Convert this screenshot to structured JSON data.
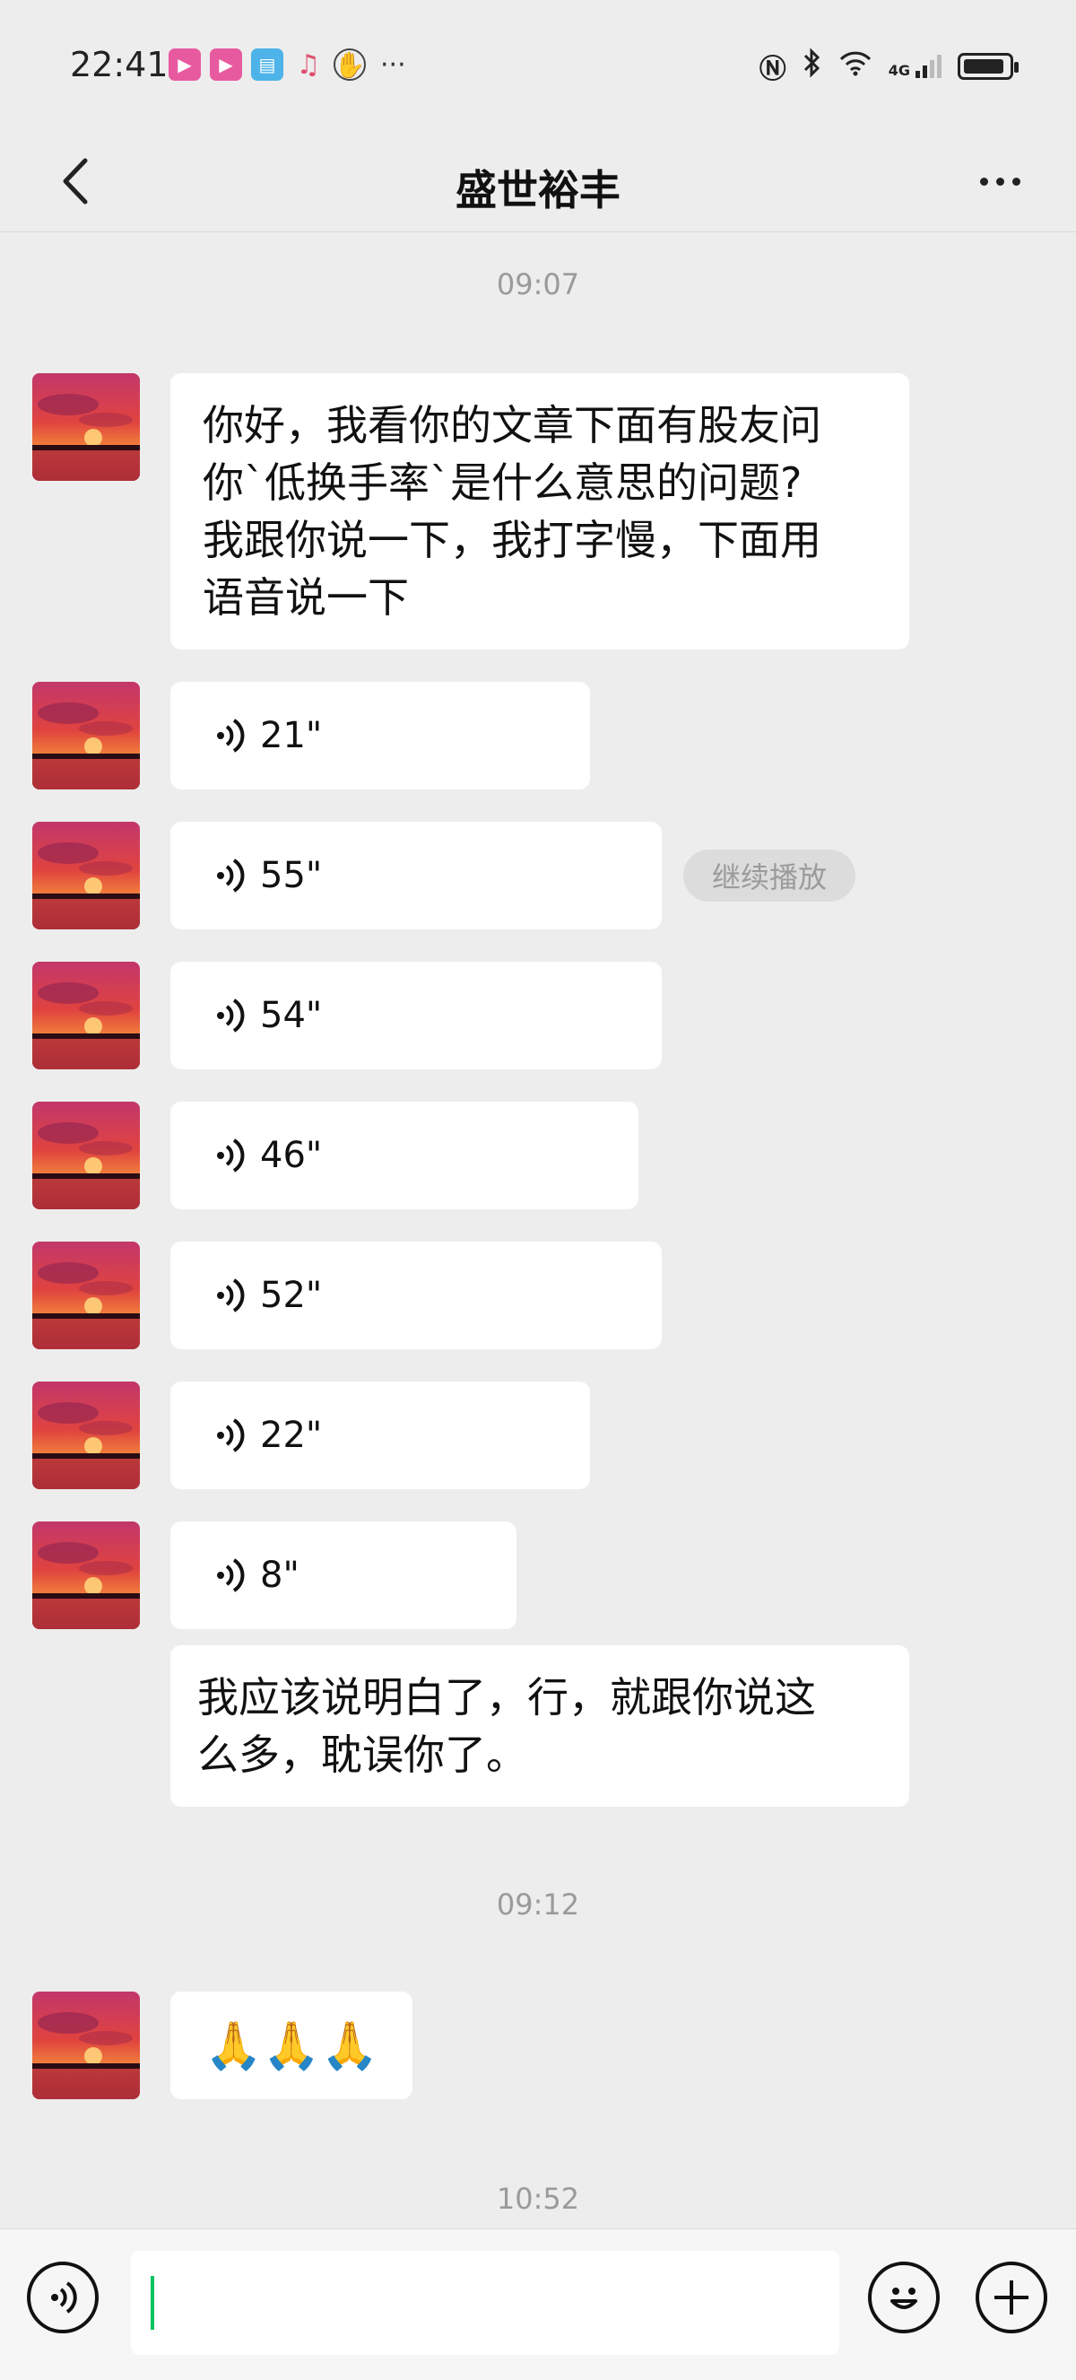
{
  "status_bar": {
    "time": "22:41",
    "app_icons": [
      "video-app-icon",
      "video-app-icon",
      "reader-app-icon",
      "music-app-icon",
      "hand-icon"
    ],
    "more": "···",
    "signal": "4G",
    "icons": [
      "nfc-icon",
      "bluetooth-icon",
      "wifi-icon",
      "signal-icon",
      "battery-icon"
    ]
  },
  "header": {
    "title": "盛世裕丰"
  },
  "timestamps": {
    "t1": "09:07",
    "t2": "09:12",
    "t3": "10:52"
  },
  "messages": {
    "text1_lines": [
      "你好，我看你的文章下面有股友问",
      "你`低换手率`是什么意思的问题?",
      "我跟你说一下，我打字慢，下面用",
      "语音说一下"
    ],
    "voice": [
      "21\"",
      "55\"",
      "54\"",
      "46\"",
      "52\"",
      "22\"",
      "8\""
    ],
    "continue_play": "继续播放",
    "text2_lines": [
      "我应该说明白了，行，就跟你说这",
      "么多，耽误你了。"
    ],
    "emoji": "🙏🙏🙏"
  },
  "input_bar": {
    "voice_toggle_icon": "voice-icon",
    "text_value": "",
    "emoji_icon": "emoji-icon",
    "add_icon": "plus-icon"
  },
  "colors": {
    "background": "#ededed",
    "bubble": "#ffffff",
    "accent_cursor": "#07c160",
    "timestamp": "#9a9a9a"
  }
}
